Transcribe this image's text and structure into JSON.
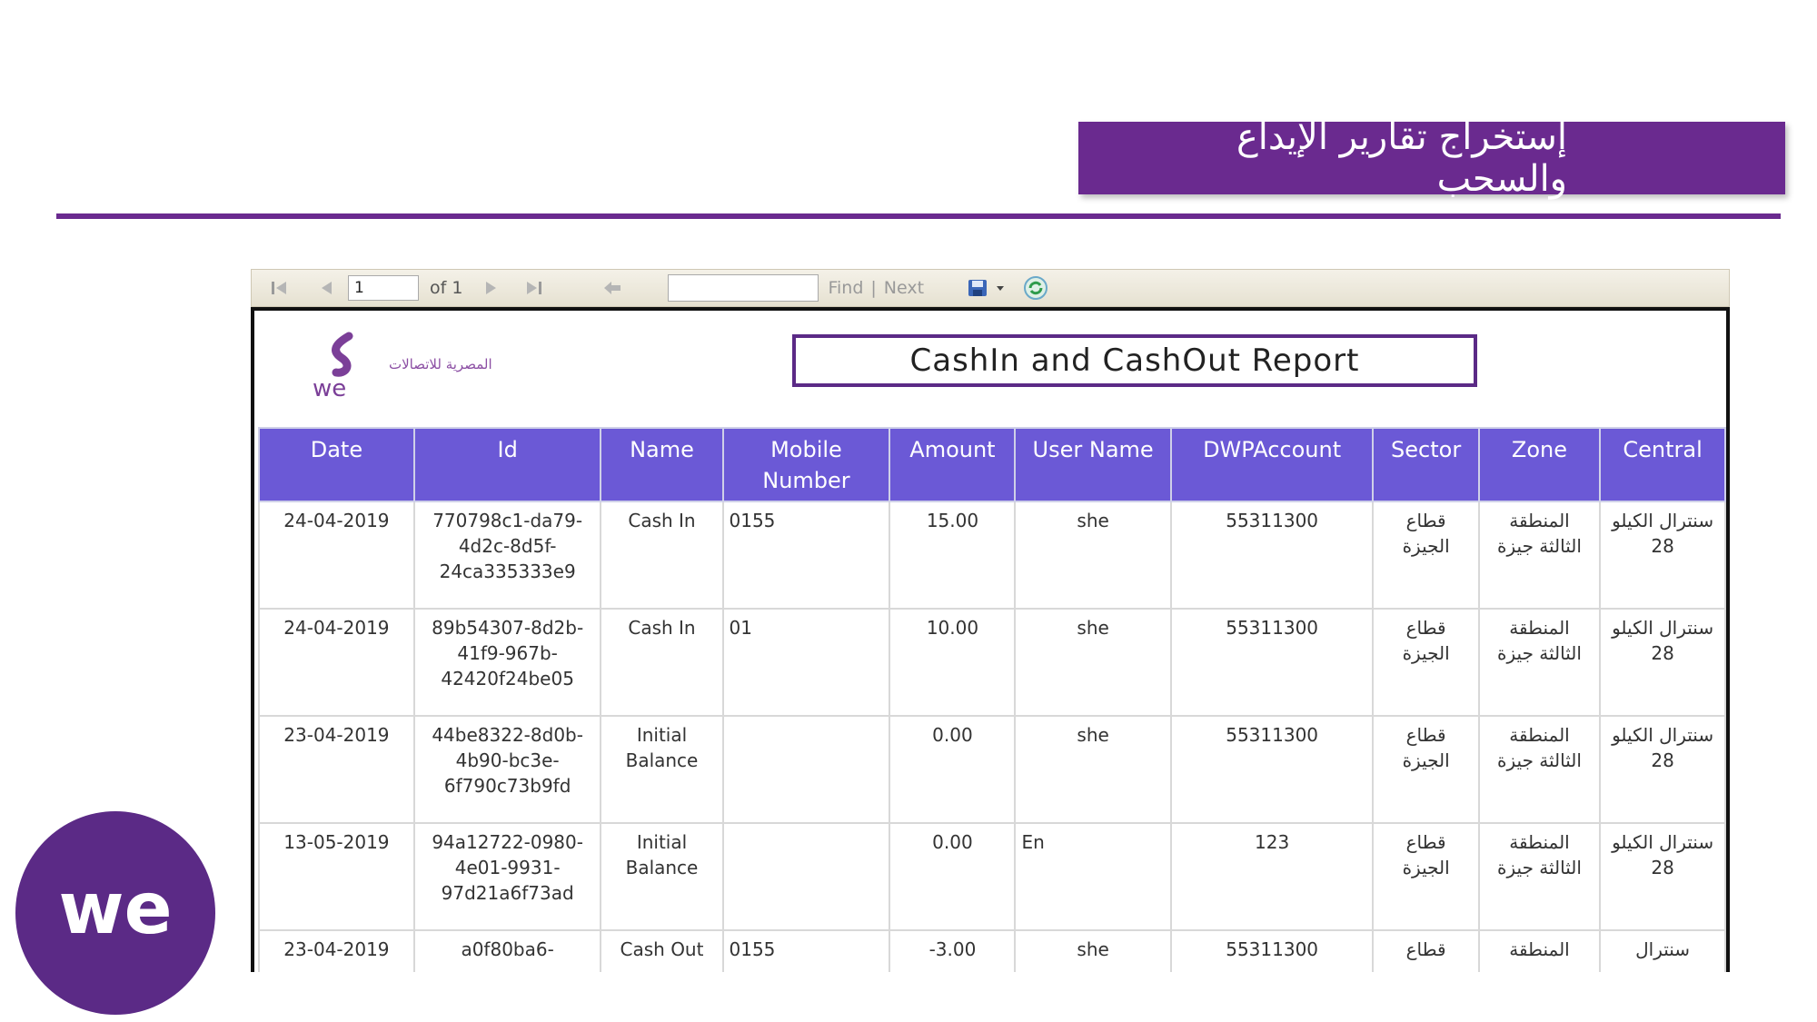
{
  "slide": {
    "title": "إستخراج تقارير الإيداع والسحب",
    "accent_color": "#6a2a8f",
    "logo_text": "we"
  },
  "toolbar": {
    "page_value": "1",
    "of_label": "of 1",
    "find_label": "Find",
    "separator": "|",
    "next_label": "Next",
    "icons": [
      "first-page-icon",
      "prev-page-icon",
      "next-page-icon",
      "last-page-icon",
      "back-icon",
      "export-save-icon",
      "refresh-icon"
    ]
  },
  "report": {
    "logo_text": "we",
    "logo_brand": "المصرية للاتصالات",
    "title": "CashIn and CashOut Report",
    "header_color": "#6b59d6",
    "columns": [
      "Date",
      "Id",
      "Name",
      "Mobile Number",
      "Amount",
      "User Name",
      "DWPAccount",
      "Sector",
      "Zone",
      "Central"
    ],
    "rows": [
      {
        "date": "24-04-2019",
        "id": "770798c1-da79-4d2c-8d5f-24ca335333e9",
        "name": "Cash In",
        "mobile": "0155",
        "amount": "15.00",
        "user": "she",
        "account": "55311300",
        "sector": "قطاع الجيزة",
        "zone": "المنطقة الثالثة جيزة",
        "central": "سنترال الكيلو 28"
      },
      {
        "date": "24-04-2019",
        "id": "89b54307-8d2b-41f9-967b-42420f24be05",
        "name": "Cash In",
        "mobile": "01",
        "amount": "10.00",
        "user": "she",
        "account": "55311300",
        "sector": "قطاع الجيزة",
        "zone": "المنطقة الثالثة جيزة",
        "central": "سنترال الكيلو 28"
      },
      {
        "date": "23-04-2019",
        "id": "44be8322-8d0b-4b90-bc3e-6f790c73b9fd",
        "name": "Initial Balance",
        "mobile": "",
        "amount": "0.00",
        "user": "she",
        "account": "55311300",
        "sector": "قطاع الجيزة",
        "zone": "المنطقة الثالثة جيزة",
        "central": "سنترال الكيلو 28"
      },
      {
        "date": "13-05-2019",
        "id": "94a12722-0980-4e01-9931-97d21a6f73ad",
        "name": "Initial Balance",
        "mobile": "",
        "amount": "0.00",
        "user": "En",
        "account": "123",
        "sector": "قطاع الجيزة",
        "zone": "المنطقة الثالثة جيزة",
        "central": "سنترال الكيلو 28"
      },
      {
        "date": "23-04-2019",
        "id": "a0f80ba6-",
        "name": "Cash Out",
        "mobile": "0155",
        "amount": "-3.00",
        "user": "she",
        "account": "55311300",
        "sector": "قطاع",
        "zone": "المنطقة",
        "central": "سنترال"
      }
    ]
  }
}
